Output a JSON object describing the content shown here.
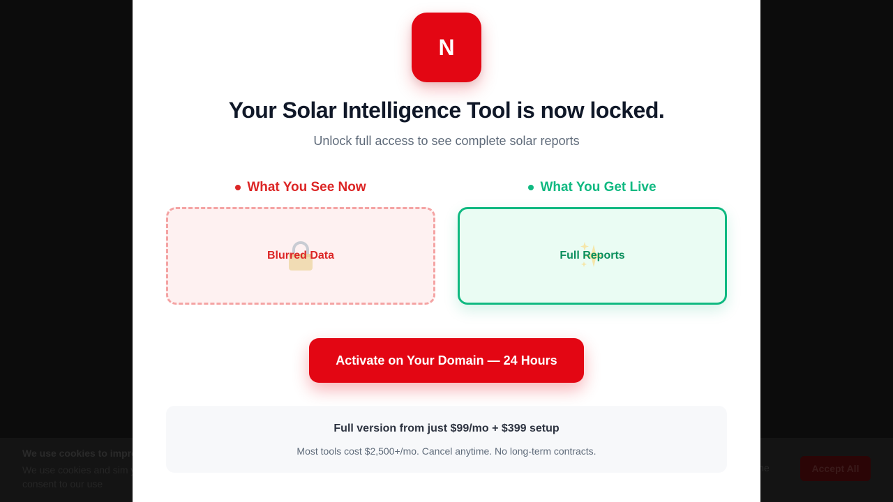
{
  "cookie_banner": {
    "title": "We use cookies to impro",
    "text": "We use cookies and sim you consent to our use",
    "decline_label": "cline",
    "accept_label": "Accept All"
  },
  "modal": {
    "logo_letter": "N",
    "title": "Your Solar Intelligence Tool is now locked.",
    "subtitle": "Unlock full access to see complete solar reports",
    "columns": [
      {
        "heading": "What You See Now",
        "card_label": "Blurred Data",
        "icon": "lock-icon",
        "accent": "#dc2626"
      },
      {
        "heading": "What You Get Live",
        "card_label": "Full Reports",
        "icon": "sparkles-icon",
        "accent": "#10b981"
      }
    ],
    "cta_label": "Activate on Your Domain — 24 Hours",
    "pricing": {
      "main": "Full version from just $99/mo + $399 setup",
      "sub": "Most tools cost $2,500+/mo. Cancel anytime. No long-term contracts."
    }
  },
  "colors": {
    "brand_red": "#e30613",
    "success_green": "#10b981",
    "danger_red": "#dc2626",
    "title_text": "#101828"
  }
}
